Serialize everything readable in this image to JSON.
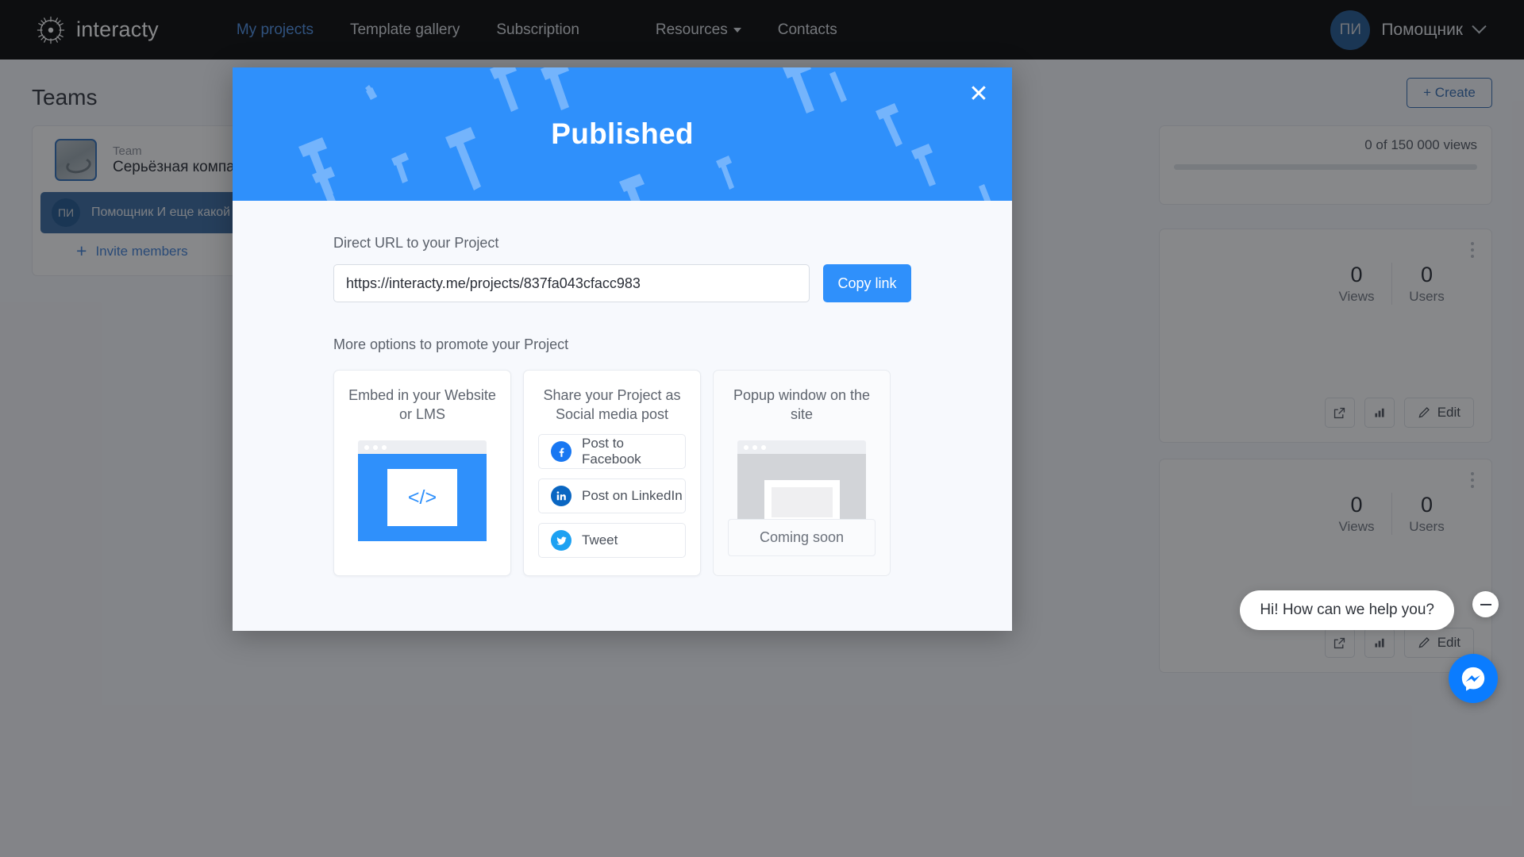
{
  "header": {
    "brand": "interacty",
    "logo_icon": "sunburst-logo-icon",
    "nav": [
      {
        "label": "My projects",
        "active": true
      },
      {
        "label": "Template gallery",
        "active": false
      },
      {
        "label": "Subscription",
        "active": false
      },
      {
        "label": "Resources",
        "active": false,
        "has_caret": true
      },
      {
        "label": "Contacts",
        "active": false
      }
    ],
    "user": {
      "initials": "ПИ",
      "name": "Помощник",
      "chevron_icon": "chevron-down-icon"
    }
  },
  "teams": {
    "title": "Teams",
    "team_label": "Team",
    "team_name": "Серьёзная компания",
    "member": {
      "initials": "ПИ",
      "name": "Помощник И еще какой (You)"
    },
    "invite_label": "Invite members",
    "invite_icon": "plus-icon"
  },
  "projects_panel": {
    "create_label": "+ Create",
    "quota_text": "0 of 150 000 views",
    "cards": [
      {
        "views_value": "0",
        "views_label": "Views",
        "users_value": "0",
        "users_label": "Users",
        "edit_label": "Edit",
        "icons": [
          "external-link-icon",
          "bar-chart-icon",
          "pencil-icon",
          "kebab-menu-icon"
        ]
      },
      {
        "views_value": "0",
        "views_label": "Views",
        "users_value": "0",
        "users_label": "Users",
        "edit_label": "Edit",
        "icons": [
          "external-link-icon",
          "bar-chart-icon",
          "pencil-icon",
          "kebab-menu-icon"
        ]
      }
    ]
  },
  "modal": {
    "title": "Published",
    "close_icon": "close-icon",
    "url_label": "Direct URL to your Project",
    "url_value": "https://interacty.me/projects/837fa043cfacc983",
    "url_placeholder": "https://interacty.me/projects/",
    "copy_label": "Copy link",
    "more_label": "More options to promote your Project",
    "cards": {
      "embed": {
        "title": "Embed in your Website or LMS",
        "icon": "code-brackets-icon",
        "glyph": "</>"
      },
      "social": {
        "title": "Share your Project as Social media post",
        "buttons": [
          {
            "label": "Post to Facebook",
            "icon": "facebook-icon",
            "color": "#1877F2"
          },
          {
            "label": "Post on LinkedIn",
            "icon": "linkedin-icon",
            "color": "#0A66C2"
          },
          {
            "label": "Tweet",
            "icon": "twitter-icon",
            "color": "#1DA1F2"
          }
        ]
      },
      "popup": {
        "title": "Popup window on the site",
        "status": "Coming soon"
      }
    }
  },
  "chat": {
    "message": "Hi! How can we help you?",
    "minimize_icon": "minimize-icon",
    "launcher_icon": "messenger-icon"
  },
  "colors": {
    "brand_blue": "#2f90fb",
    "header_black": "#000000",
    "page_bg": "#f7f8fc",
    "nav_active": "#4a8fe7"
  }
}
